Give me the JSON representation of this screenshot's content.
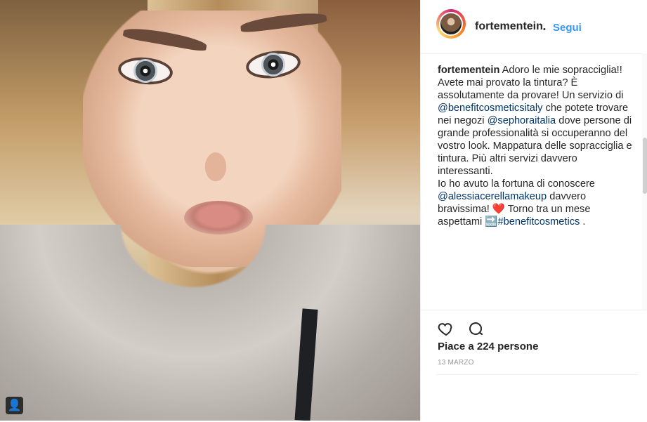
{
  "post": {
    "username": "fortementein",
    "follow_label": "Segui",
    "bullet": "•",
    "caption_prefix": "fortementein",
    "caption_parts": [
      "Adoro le mie sopracciglia!! Avete mai provato la tintura? È assolutamente da provare! Un servizio di ",
      "@benefitcosmeticsitaly",
      " che potete trovare nei negozi ",
      "@sephoraitalia",
      " dove persone di grande professionalità si occuperanno del vostro look. Mappatura delle sopracciglia e tintura. Più altri servizi davvero interessanti.",
      "Io ho avuto la fortuna di conoscere ",
      "@alessiacerellamakeup",
      " davvero bravissima! ❤️ Torno tra un mese aspettami 🔜",
      "#benefitcosmetics",
      " ."
    ],
    "likes_label": "Piace a 224 persone",
    "date_label": "13 MARZO"
  },
  "icons": {
    "heart": "heart-icon",
    "comment": "comment-icon",
    "user": "user-tag-icon"
  },
  "colors": {
    "link": "#3897f0",
    "mention": "#003569",
    "text": "#262626",
    "muted": "#999999"
  }
}
